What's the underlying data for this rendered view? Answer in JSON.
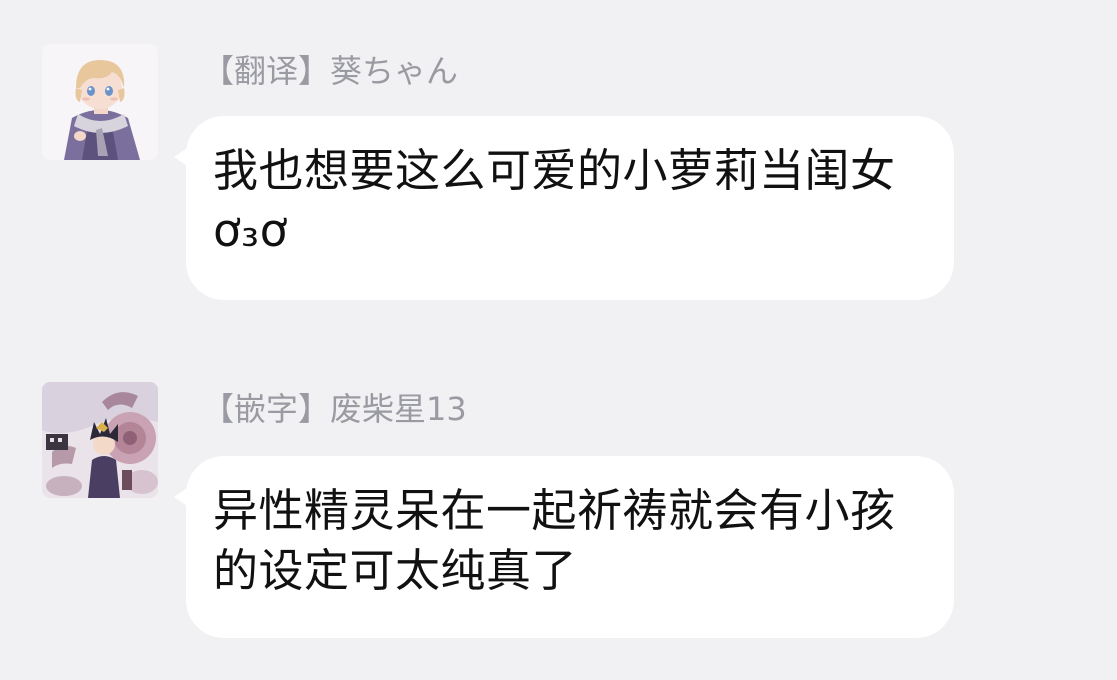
{
  "messages": [
    {
      "sender": "【翻译】葵ちゃん",
      "text": "我也想要这么可爱的小萝莉当闺女ơ₃ơ",
      "avatar_icon": "anime-boy-scarf-avatar"
    },
    {
      "sender": "【嵌字】废柴星13",
      "text": "异性精灵呆在一起祈祷就会有小孩的设定可太纯真了",
      "avatar_icon": "anime-character-with-machine-avatar"
    }
  ],
  "colors": {
    "background": "#f1f1f3",
    "bubble": "#ffffff",
    "sender_name": "#9a9aa2",
    "message_text": "#111111"
  }
}
